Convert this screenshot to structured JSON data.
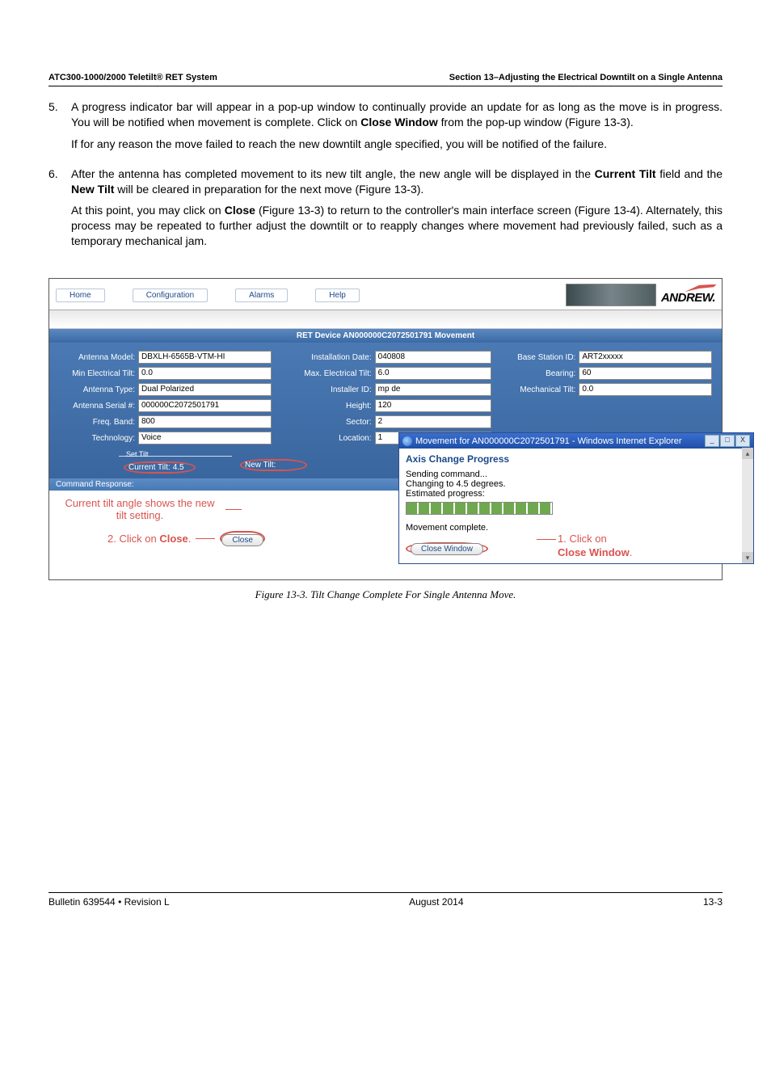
{
  "header": {
    "left": "ATC300-1000/2000 Teletilt® RET System",
    "right": "Section 13–Adjusting the Electrical Downtilt on a Single Antenna"
  },
  "steps": [
    {
      "num": "5.",
      "paras": [
        "A progress indicator bar will appear in a pop-up window to continually provide an update for as long as the move is in progress. You will be notified when movement is complete. Click on <b>Close Window</b> from the pop-up window (Figure 13-3).",
        "If for any reason the move failed to reach the new downtilt angle specified, you will be notified of the failure."
      ]
    },
    {
      "num": "6.",
      "paras": [
        "After the antenna has completed movement to its new tilt angle, the new angle will be displayed in the <b>Current Tilt</b> field and the <b>New Tilt</b> will be cleared in preparation for the next move (Figure 13-3).",
        "At this point, you may click on <b>Close</b> (Figure 13-3) to return to the controller's main interface screen (Figure 13-4). Alternately, this process may be repeated to further adjust the downtilt or to reapply changes where movement had previously failed, such as a temporary mechanical jam."
      ]
    }
  ],
  "app": {
    "nav": {
      "home": "Home",
      "config": "Configuration",
      "alarms": "Alarms",
      "help": "Help"
    },
    "brand": "ANDREW.",
    "section_title": "RET Device AN000000C2072501791 Movement",
    "fields": {
      "antenna_model_label": "Antenna Model:",
      "antenna_model": "DBXLH-6565B-VTM-HI",
      "install_date_label": "Installation Date:",
      "install_date": "040808",
      "base_station_label": "Base Station ID:",
      "base_station": "ART2xxxxx",
      "min_tilt_label": "Min Electrical Tilt:",
      "min_tilt": "0.0",
      "max_tilt_label": "Max. Electrical Tilt:",
      "max_tilt": "6.0",
      "bearing_label": "Bearing:",
      "bearing": "60",
      "ant_type_label": "Antenna Type:",
      "ant_type": "Dual Polarized",
      "installer_label": "Installer ID:",
      "installer": "mp de",
      "mech_tilt_label": "Mechanical Tilt:",
      "mech_tilt": "0.0",
      "serial_label": "Antenna Serial #:",
      "serial": "000000C2072501791",
      "height_label": "Height:",
      "height": "120",
      "freq_label": "Freq. Band:",
      "freq": "800",
      "sector_label": "Sector:",
      "sector": "2",
      "tech_label": "Technology:",
      "tech": "Voice",
      "location_label": "Location:",
      "location": "1"
    },
    "set_tilt_legend": "Set Tilt",
    "current_tilt_label": "Current Tilt:",
    "current_tilt": "4.5",
    "new_tilt_label": "New Tilt:",
    "command_response": "Command Response:",
    "annotations": {
      "current_tilt_shows": "Current tilt angle shows the new tilt setting.",
      "click_close_prefix": "2.  Click on ",
      "click_close_bold": "Close",
      "click_close_suffix": "."
    },
    "close_btn": "Close"
  },
  "popup": {
    "title": "Movement for AN000000C2072501791 - Windows Internet Explorer",
    "heading": "Axis Change Progress",
    "l1": "Sending command...",
    "l2": "Changing to 4.5 degrees.",
    "l3": "Estimated progress:",
    "l4": "Movement complete.",
    "close_btn": "Close Window",
    "note_prefix": "1.  Click on",
    "note_bold": "Close Window",
    "note_suffix": "."
  },
  "figure_caption": "Figure 13-3.  Tilt Change Complete For Single Antenna Move.",
  "footer": {
    "left": "Bulletin 639544  •  Revision L",
    "center": "August 2014",
    "right": "13-3"
  }
}
